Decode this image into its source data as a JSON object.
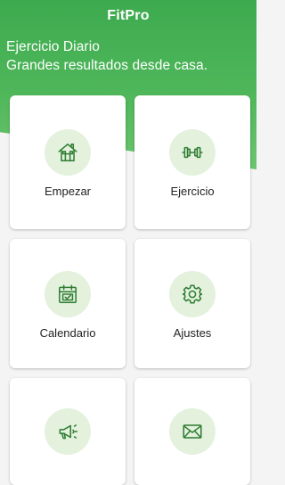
{
  "appbar": {
    "title": "FitPro"
  },
  "header": {
    "line1": "Ejercicio Diario",
    "line2": "Grandes resultados desde casa."
  },
  "theme": {
    "primary": "#4caf50",
    "icon_bg": "#e3f1dd",
    "icon_stroke": "#2e7d32"
  },
  "cards": [
    {
      "label": "Empezar",
      "icon": "home-icon"
    },
    {
      "label": "Ejercicio",
      "icon": "dumbbell-icon"
    },
    {
      "label": "Calendario",
      "icon": "calendar-icon"
    },
    {
      "label": "Ajustes",
      "icon": "gear-icon"
    },
    {
      "label": "",
      "icon": "megaphone-icon"
    },
    {
      "label": "",
      "icon": "mail-icon"
    }
  ]
}
